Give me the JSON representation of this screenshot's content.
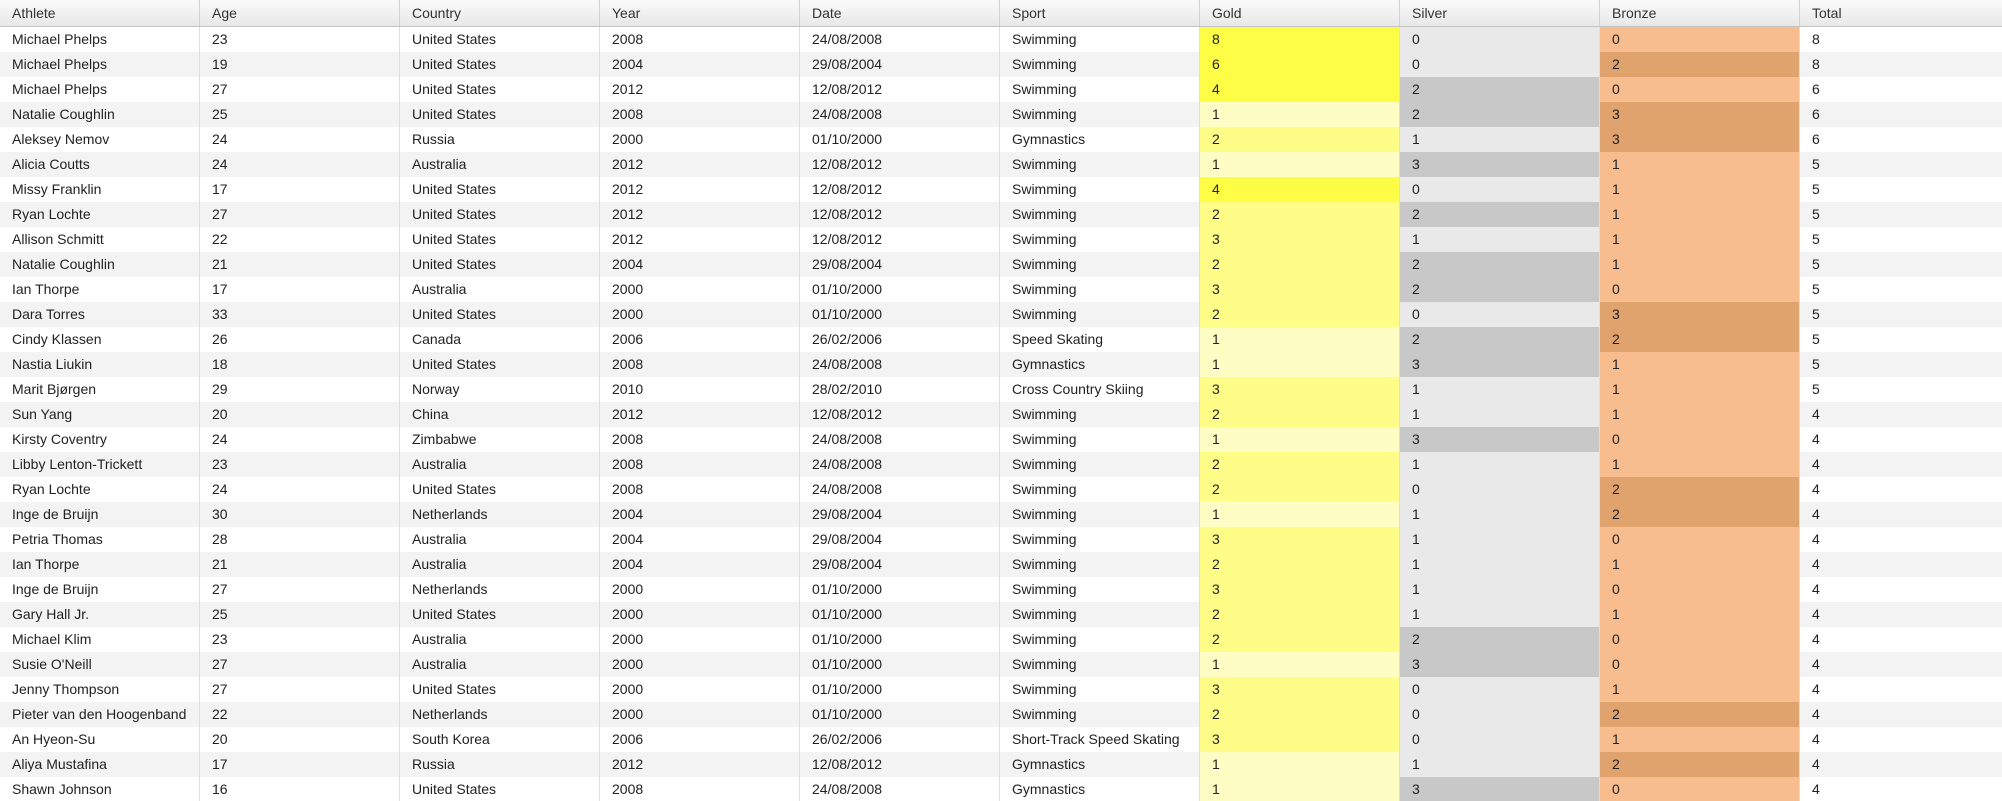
{
  "columns": [
    "Athlete",
    "Age",
    "Country",
    "Year",
    "Date",
    "Sport",
    "Gold",
    "Silver",
    "Bronze",
    "Total"
  ],
  "medal_colors": {
    "gold": {
      "low": "#fdfdc4",
      "mid": "#fdfd88",
      "high": "#fdfd45"
    },
    "silver": {
      "low": "#e9e9e9",
      "high": "#c8c8c8"
    },
    "bronze": {
      "low": "#f7bd8f",
      "high": "#e0a36e"
    }
  },
  "rows": [
    [
      "Michael Phelps",
      "23",
      "United States",
      "2008",
      "24/08/2008",
      "Swimming",
      "8",
      "0",
      "0",
      "8"
    ],
    [
      "Michael Phelps",
      "19",
      "United States",
      "2004",
      "29/08/2004",
      "Swimming",
      "6",
      "0",
      "2",
      "8"
    ],
    [
      "Michael Phelps",
      "27",
      "United States",
      "2012",
      "12/08/2012",
      "Swimming",
      "4",
      "2",
      "0",
      "6"
    ],
    [
      "Natalie Coughlin",
      "25",
      "United States",
      "2008",
      "24/08/2008",
      "Swimming",
      "1",
      "2",
      "3",
      "6"
    ],
    [
      "Aleksey Nemov",
      "24",
      "Russia",
      "2000",
      "01/10/2000",
      "Gymnastics",
      "2",
      "1",
      "3",
      "6"
    ],
    [
      "Alicia Coutts",
      "24",
      "Australia",
      "2012",
      "12/08/2012",
      "Swimming",
      "1",
      "3",
      "1",
      "5"
    ],
    [
      "Missy Franklin",
      "17",
      "United States",
      "2012",
      "12/08/2012",
      "Swimming",
      "4",
      "0",
      "1",
      "5"
    ],
    [
      "Ryan Lochte",
      "27",
      "United States",
      "2012",
      "12/08/2012",
      "Swimming",
      "2",
      "2",
      "1",
      "5"
    ],
    [
      "Allison Schmitt",
      "22",
      "United States",
      "2012",
      "12/08/2012",
      "Swimming",
      "3",
      "1",
      "1",
      "5"
    ],
    [
      "Natalie Coughlin",
      "21",
      "United States",
      "2004",
      "29/08/2004",
      "Swimming",
      "2",
      "2",
      "1",
      "5"
    ],
    [
      "Ian Thorpe",
      "17",
      "Australia",
      "2000",
      "01/10/2000",
      "Swimming",
      "3",
      "2",
      "0",
      "5"
    ],
    [
      "Dara Torres",
      "33",
      "United States",
      "2000",
      "01/10/2000",
      "Swimming",
      "2",
      "0",
      "3",
      "5"
    ],
    [
      "Cindy Klassen",
      "26",
      "Canada",
      "2006",
      "26/02/2006",
      "Speed Skating",
      "1",
      "2",
      "2",
      "5"
    ],
    [
      "Nastia Liukin",
      "18",
      "United States",
      "2008",
      "24/08/2008",
      "Gymnastics",
      "1",
      "3",
      "1",
      "5"
    ],
    [
      "Marit Bjørgen",
      "29",
      "Norway",
      "2010",
      "28/02/2010",
      "Cross Country Skiing",
      "3",
      "1",
      "1",
      "5"
    ],
    [
      "Sun Yang",
      "20",
      "China",
      "2012",
      "12/08/2012",
      "Swimming",
      "2",
      "1",
      "1",
      "4"
    ],
    [
      "Kirsty Coventry",
      "24",
      "Zimbabwe",
      "2008",
      "24/08/2008",
      "Swimming",
      "1",
      "3",
      "0",
      "4"
    ],
    [
      "Libby Lenton-Trickett",
      "23",
      "Australia",
      "2008",
      "24/08/2008",
      "Swimming",
      "2",
      "1",
      "1",
      "4"
    ],
    [
      "Ryan Lochte",
      "24",
      "United States",
      "2008",
      "24/08/2008",
      "Swimming",
      "2",
      "0",
      "2",
      "4"
    ],
    [
      "Inge de Bruijn",
      "30",
      "Netherlands",
      "2004",
      "29/08/2004",
      "Swimming",
      "1",
      "1",
      "2",
      "4"
    ],
    [
      "Petria Thomas",
      "28",
      "Australia",
      "2004",
      "29/08/2004",
      "Swimming",
      "3",
      "1",
      "0",
      "4"
    ],
    [
      "Ian Thorpe",
      "21",
      "Australia",
      "2004",
      "29/08/2004",
      "Swimming",
      "2",
      "1",
      "1",
      "4"
    ],
    [
      "Inge de Bruijn",
      "27",
      "Netherlands",
      "2000",
      "01/10/2000",
      "Swimming",
      "3",
      "1",
      "0",
      "4"
    ],
    [
      "Gary Hall Jr.",
      "25",
      "United States",
      "2000",
      "01/10/2000",
      "Swimming",
      "2",
      "1",
      "1",
      "4"
    ],
    [
      "Michael Klim",
      "23",
      "Australia",
      "2000",
      "01/10/2000",
      "Swimming",
      "2",
      "2",
      "0",
      "4"
    ],
    [
      "Susie O'Neill",
      "27",
      "Australia",
      "2000",
      "01/10/2000",
      "Swimming",
      "1",
      "3",
      "0",
      "4"
    ],
    [
      "Jenny Thompson",
      "27",
      "United States",
      "2000",
      "01/10/2000",
      "Swimming",
      "3",
      "0",
      "1",
      "4"
    ],
    [
      "Pieter van den Hoogenband",
      "22",
      "Netherlands",
      "2000",
      "01/10/2000",
      "Swimming",
      "2",
      "0",
      "2",
      "4"
    ],
    [
      "An Hyeon-Su",
      "20",
      "South Korea",
      "2006",
      "26/02/2006",
      "Short-Track Speed Skating",
      "3",
      "0",
      "1",
      "4"
    ],
    [
      "Aliya Mustafina",
      "17",
      "Russia",
      "2012",
      "12/08/2012",
      "Gymnastics",
      "1",
      "1",
      "2",
      "4"
    ],
    [
      "Shawn Johnson",
      "16",
      "United States",
      "2008",
      "24/08/2008",
      "Gymnastics",
      "1",
      "3",
      "0",
      "4"
    ]
  ]
}
